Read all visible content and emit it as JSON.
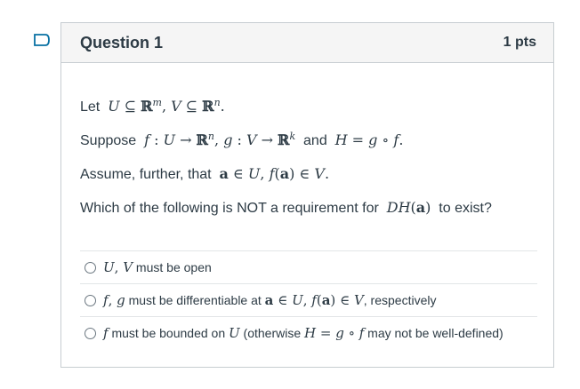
{
  "question": {
    "title": "Question 1",
    "points": "1 pts",
    "flag_icon": "bookmark-flag-icon"
  },
  "body": {
    "line1": {
      "prefix": "Let ",
      "math": "U ⊆ ℝ^m, V ⊆ ℝ^n."
    },
    "line2": {
      "prefix": "Suppose ",
      "math1": "f : U → ℝ^n, g : V → ℝ^k",
      "middle": " and ",
      "math2": "H = g ∘ f."
    },
    "line3": {
      "prefix": "Assume, further, that ",
      "math": "a ∈ U, f(a) ∈ V."
    },
    "line4": {
      "prefix": "Which of the following is NOT a requirement for ",
      "math": "DH(a)",
      "suffix": " to exist?"
    }
  },
  "answers": [
    {
      "math": "U, V",
      "text": " must be open"
    },
    {
      "math": "f, g",
      "text": " must be differentiable at ",
      "math2": "a ∈ U, f(a) ∈ V",
      "text2": ", respectively"
    },
    {
      "math": "f",
      "text": " must be bounded on ",
      "math2": "U",
      "text2": " (otherwise ",
      "math3": "H = g ∘ f",
      "text3": " may not be well-defined)"
    }
  ]
}
